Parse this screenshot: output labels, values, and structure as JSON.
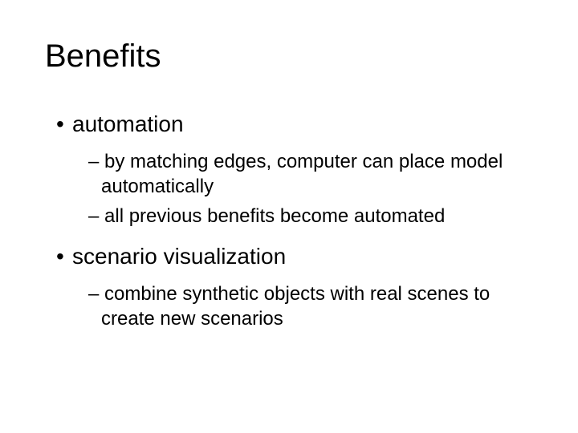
{
  "title": "Benefits",
  "items": [
    {
      "label": "automation",
      "sub": [
        "by matching edges, computer can place model automatically",
        "all previous benefits become automated"
      ]
    },
    {
      "label": "scenario visualization",
      "sub": [
        "combine synthetic objects with real scenes to create new scenarios"
      ]
    }
  ],
  "markers": {
    "l1": "•",
    "l2": "–"
  }
}
